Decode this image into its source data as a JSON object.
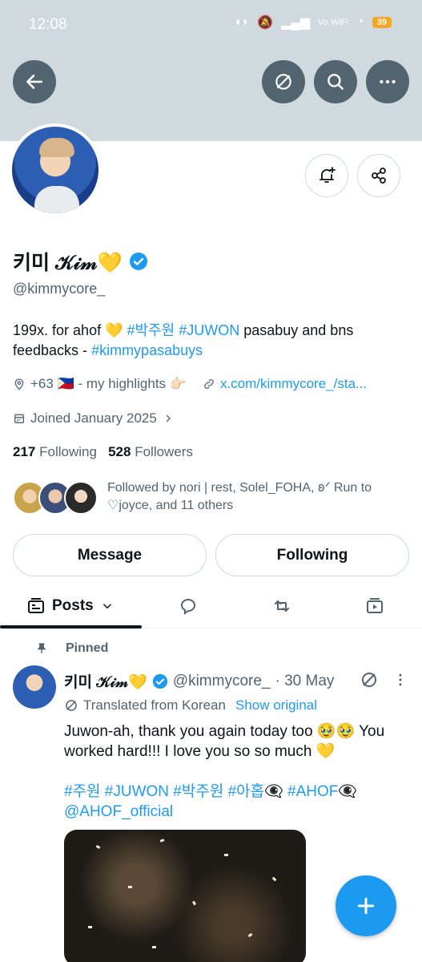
{
  "status_bar": {
    "time": "12:08",
    "signal_text": "Vo WiFi",
    "battery": "39"
  },
  "profile": {
    "display_name": "키미 𝒦𝒾𝓂💛",
    "handle": "@kimmycore_",
    "bio_plain_1": "199x. for ahof 💛 ",
    "bio_tag_1": "#박주원",
    "bio_space": " ",
    "bio_tag_2": "#JUWON",
    "bio_plain_2": " pasabuy and bns feedbacks - ",
    "bio_tag_3": "#kimmypasabuys",
    "location": "+63 🇵🇭 - my highlights 👉🏻",
    "website": "x.com/kimmycore_/sta...",
    "joined": "Joined January 2025",
    "following_count": "217",
    "following_label": "Following",
    "followers_count": "528",
    "followers_label": "Followers",
    "followed_by": "Followed by nori | rest, Solel_FOHA, 𐐪ᐟ Run to ♡joyce, and 11 others"
  },
  "actions": {
    "message_label": "Message",
    "following_label": "Following"
  },
  "tabs": {
    "posts_label": "Posts"
  },
  "post": {
    "pinned_label": "Pinned",
    "author_name": "키미 𝒦𝒾𝓂💛",
    "author_handle": "@kimmycore_",
    "date": "· 30 May",
    "translated_label": "Translated from Korean",
    "show_original": "Show original",
    "text": "Juwon-ah, thank you again today too 🥹🥹 You worked hard!!! I love you so so much 💛",
    "tags": "#주원 #JUWON #박주원 #아홉👁‍🗨 #AHOF👁‍🗨 @AHOF_official"
  },
  "colors": {
    "accent": "#1d9bf0",
    "banner": "#cfd9de",
    "muted": "#536471"
  },
  "icons": [
    "back-arrow-icon",
    "grok-icon",
    "search-icon",
    "more-icon",
    "bell-plus-icon",
    "share-icon",
    "verified-icon",
    "location-icon",
    "link-icon",
    "calendar-icon",
    "chevron-right-icon",
    "posts-icon",
    "chevron-down-icon",
    "reply-icon",
    "repost-icon",
    "media-icon",
    "pin-icon",
    "plus-icon"
  ]
}
